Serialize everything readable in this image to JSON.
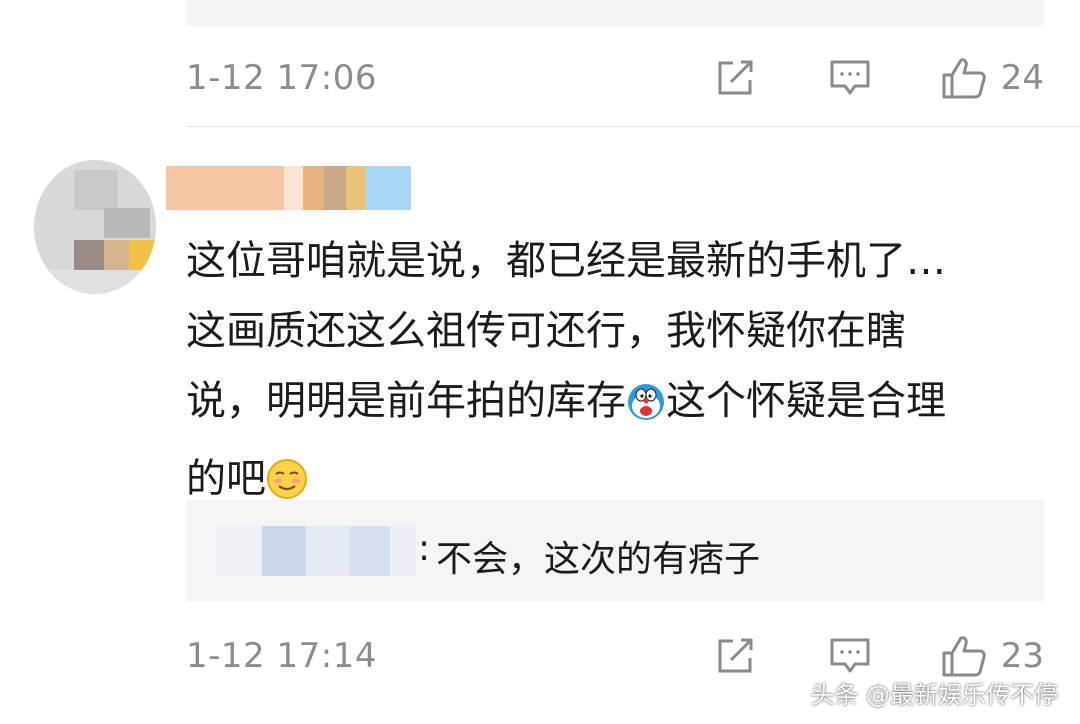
{
  "previous_comment": {
    "timestamp": "1-12 17:06",
    "like_count": "24"
  },
  "comment": {
    "text_line1": "这位哥咱就是说，都已经是最新的手机了…",
    "text_line2": "这画质还这么祖传可还行，我怀疑你在瞎",
    "text_line3_a": "说，明明是前年拍的库存",
    "text_line3_b": "这个怀疑是合理",
    "text_line4": "的吧",
    "emoji_1": "doraemon-icon",
    "emoji_2": "smirk-emoji-icon",
    "reply": {
      "colon": ":",
      "text": "不会，这次的有痞子"
    },
    "timestamp": "1-12 17:14",
    "like_count": "23"
  },
  "watermark": "头条 @最新娱乐传不停",
  "colors": {
    "meta_gray": "#8c8c8c",
    "reply_bg": "#f5f5f5",
    "text": "#1b1b1b"
  }
}
